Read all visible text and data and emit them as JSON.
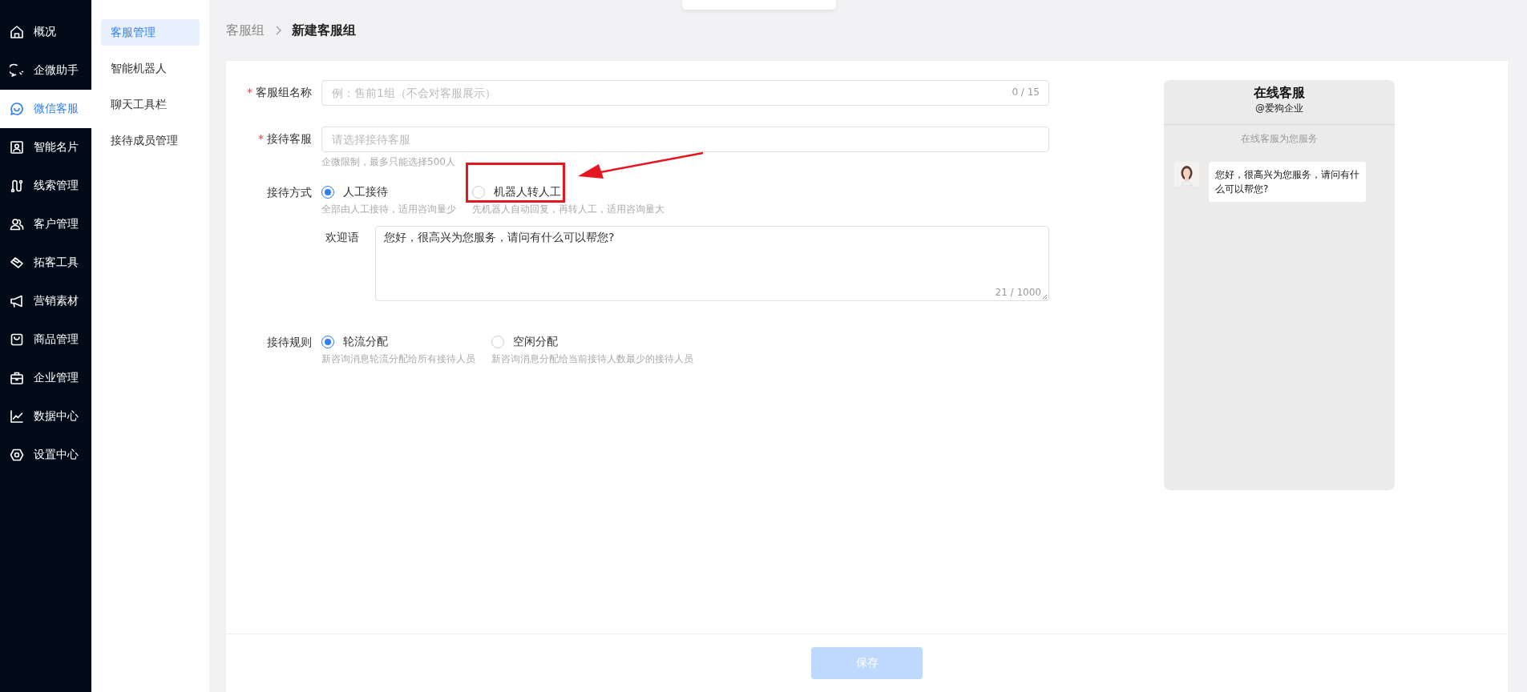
{
  "nav": [
    {
      "label": "概况",
      "selected": false
    },
    {
      "label": "企微助手",
      "selected": false
    },
    {
      "label": "微信客服",
      "selected": true
    },
    {
      "label": "智能名片",
      "selected": false
    },
    {
      "label": "线索管理",
      "selected": false
    },
    {
      "label": "客户管理",
      "selected": false
    },
    {
      "label": "拓客工具",
      "selected": false
    },
    {
      "label": "营销素材",
      "selected": false
    },
    {
      "label": "商品管理",
      "selected": false
    },
    {
      "label": "企业管理",
      "selected": false
    },
    {
      "label": "数据中心",
      "selected": false
    },
    {
      "label": "设置中心",
      "selected": false
    }
  ],
  "subnav": [
    {
      "label": "客服管理",
      "selected": true
    },
    {
      "label": "智能机器人",
      "selected": false
    },
    {
      "label": "聊天工具栏",
      "selected": false
    },
    {
      "label": "接待成员管理",
      "selected": false
    }
  ],
  "breadcrumb": [
    {
      "label": "客服组",
      "current": false
    },
    {
      "label": "新建客服组",
      "current": true
    }
  ],
  "form": {
    "name_field": {
      "label": "客服组名称",
      "required_mark": "*",
      "placeholder": "例：售前1组（不会对客服展示）",
      "counter": "0 / 15"
    },
    "agent_field": {
      "label": "接待客服",
      "required_mark": "*",
      "placeholder": "请选择接待客服",
      "hint": "企微限制，最多只能选择500人"
    },
    "mode": {
      "label": "接待方式",
      "options": [
        {
          "label": "人工接待",
          "hint": "全部由人工接待，适用咨询量少",
          "selected": true,
          "highlighted": false
        },
        {
          "label": "机器人转人工",
          "hint": "先机器人自动回复，再转人工，适用咨询量大",
          "selected": false,
          "highlighted": true
        }
      ]
    },
    "welcome": {
      "label": "欢迎语",
      "value": "您好，很高兴为您服务，请问有什么可以帮您?",
      "counter": "21 / 1000"
    },
    "rule": {
      "label": "接待规则",
      "options": [
        {
          "label": "轮流分配",
          "hint": "新咨询消息轮流分配给所有接待人员",
          "selected": true,
          "highlighted": false
        },
        {
          "label": "空闲分配",
          "hint": "新咨询消息分配给当前接待人数最少的接待人员",
          "selected": false,
          "highlighted": false
        }
      ]
    }
  },
  "save_button": {
    "label": "保存",
    "disabled": true
  },
  "preview": {
    "title": "在线客服",
    "subtitle": "@爱狗企业",
    "notice": "在线客服为您服务",
    "messages": [
      {
        "text": "您好，很高兴为您服务，请问有什么可以帮您?"
      }
    ]
  }
}
